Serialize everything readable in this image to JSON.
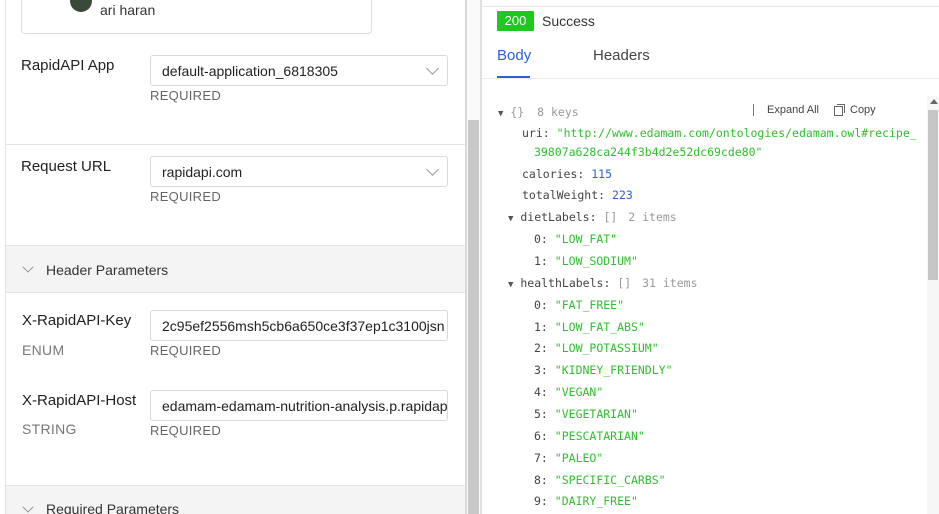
{
  "user": {
    "name": "ari haran"
  },
  "left": {
    "rapidapi_app": {
      "label": "RapidAPI App",
      "value": "default-application_6818305",
      "required": "REQUIRED"
    },
    "request_url": {
      "label": "Request URL",
      "value": "rapidapi.com",
      "required": "REQUIRED"
    },
    "header_section": {
      "title": "Header Parameters"
    },
    "headers": [
      {
        "label": "X-RapidAPI-Key",
        "type": "ENUM",
        "value": "2c95ef2556msh5cb6a650ce3f37ep1c3100jsn",
        "required": "REQUIRED"
      },
      {
        "label": "X-RapidAPI-Host",
        "type": "STRING",
        "value": "edamam-edamam-nutrition-analysis.p.rapidapi.com",
        "required": "REQUIRED"
      }
    ],
    "required_section": {
      "title": "Required Parameters"
    }
  },
  "response": {
    "status_code": "200",
    "status_text": "Success",
    "tabs": {
      "body": "Body",
      "headers": "Headers"
    },
    "tools": {
      "expand_all": "Expand All",
      "copy": "Copy"
    },
    "root": {
      "brace": "{}",
      "count": "8 keys"
    },
    "uri": {
      "key": "uri:",
      "value_line1": "\"http://www.edamam.com/ontologies/edamam.owl#recipe_",
      "value_line2": "39807a628ca244f3b4d2e52dc69cde80\""
    },
    "calories": {
      "key": "calories:",
      "value": "115"
    },
    "totalWeight": {
      "key": "totalWeight:",
      "value": "223"
    },
    "dietLabels": {
      "key": "dietLabels:",
      "brackets": "[]",
      "count": "2 items",
      "items": [
        {
          "idx": "0:",
          "val": "\"LOW_FAT\""
        },
        {
          "idx": "1:",
          "val": "\"LOW_SODIUM\""
        }
      ]
    },
    "healthLabels": {
      "key": "healthLabels:",
      "brackets": "[]",
      "count": "31 items",
      "items": [
        {
          "idx": "0:",
          "val": "\"FAT_FREE\""
        },
        {
          "idx": "1:",
          "val": "\"LOW_FAT_ABS\""
        },
        {
          "idx": "2:",
          "val": "\"LOW_POTASSIUM\""
        },
        {
          "idx": "3:",
          "val": "\"KIDNEY_FRIENDLY\""
        },
        {
          "idx": "4:",
          "val": "\"VEGAN\""
        },
        {
          "idx": "5:",
          "val": "\"VEGETARIAN\""
        },
        {
          "idx": "6:",
          "val": "\"PESCATARIAN\""
        },
        {
          "idx": "7:",
          "val": "\"PALEO\""
        },
        {
          "idx": "8:",
          "val": "\"SPECIFIC_CARBS\""
        },
        {
          "idx": "9:",
          "val": "\"DAIRY_FREE\""
        }
      ]
    }
  }
}
